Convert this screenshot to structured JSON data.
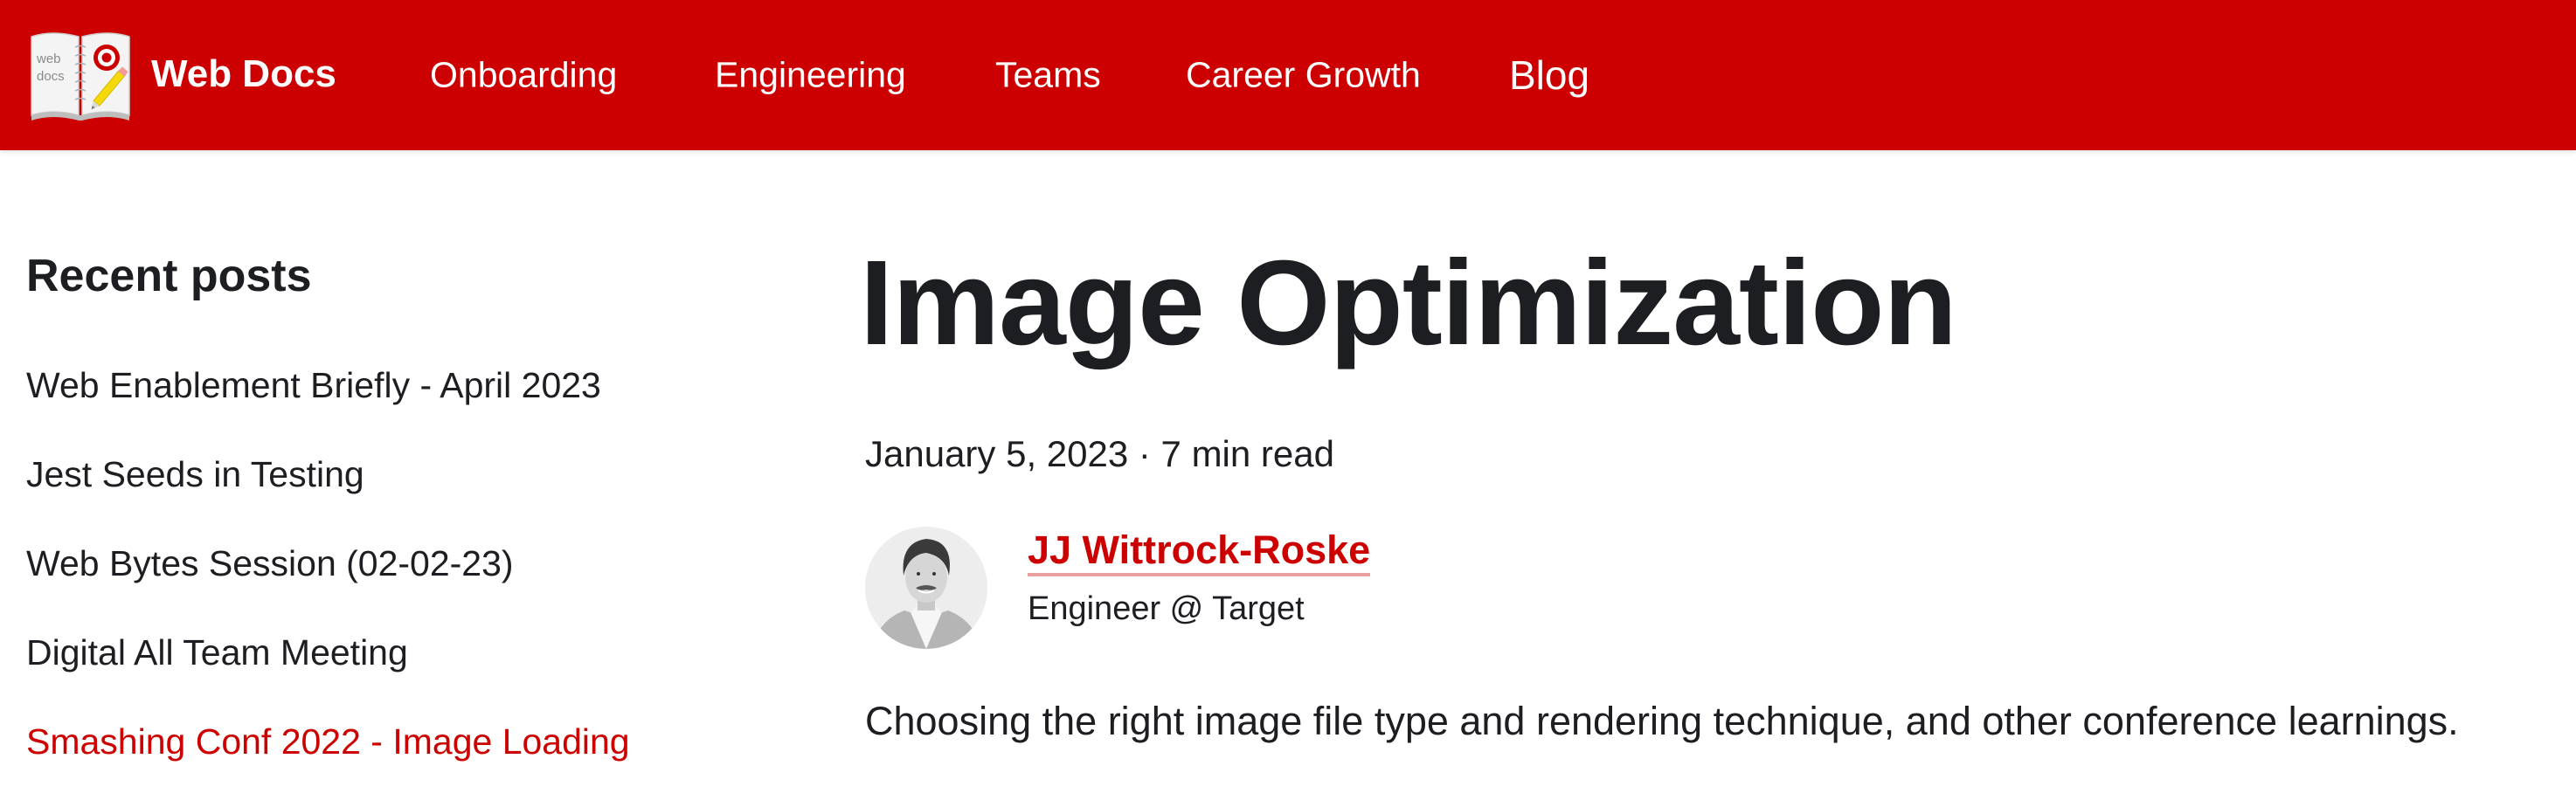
{
  "navbar": {
    "brand": {
      "title": "Web Docs",
      "logo_icon": "open-notebook-with-target-logo-and-pencil-icon",
      "logo_text_line1": "web",
      "logo_text_line2": "docs"
    },
    "links": [
      {
        "label": "Onboarding",
        "active": false
      },
      {
        "label": "Engineering",
        "active": false
      },
      {
        "label": "Teams",
        "active": false
      },
      {
        "label": "Career Growth",
        "active": false
      },
      {
        "label": "Blog",
        "active": true
      }
    ],
    "colors": {
      "background": "#cc0000",
      "text": "#ffffff"
    }
  },
  "sidebar": {
    "title": "Recent posts",
    "items": [
      {
        "label": "Web Enablement Briefly - April 2023",
        "active": false
      },
      {
        "label": "Jest Seeds in Testing",
        "active": false
      },
      {
        "label": "Web Bytes Session (02-02-23)",
        "active": false
      },
      {
        "label": "Digital All Team Meeting",
        "active": false
      },
      {
        "label": "Smashing Conf 2022 - Image Loading",
        "active": true
      }
    ]
  },
  "post": {
    "title": "Image Optimization",
    "meta": "January 5, 2023 · 7 min read",
    "author": {
      "name": "JJ Wittrock-Roske",
      "title": "Engineer @ Target",
      "avatar": "author-avatar-photo"
    },
    "description": "Choosing the right image file type and rendering technique, and other conference learnings."
  },
  "colors": {
    "accent": "#cc0000",
    "text": "#1c1e21",
    "link_underline": "#eba0a0"
  }
}
